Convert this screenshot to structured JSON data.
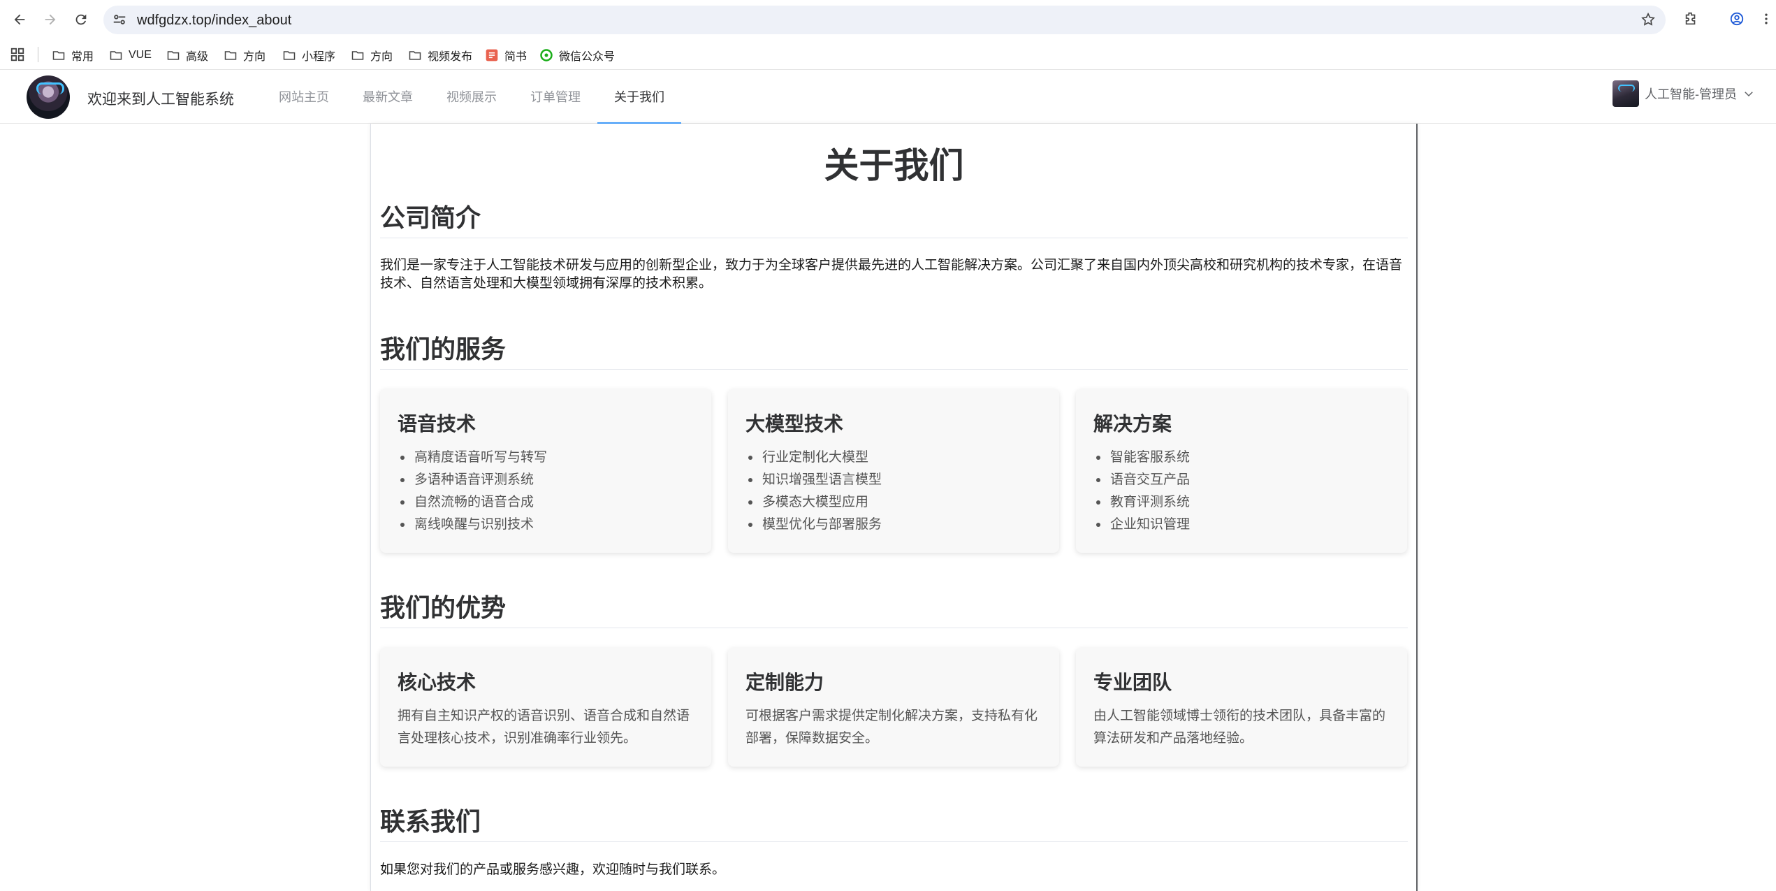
{
  "browser": {
    "url": "wdfgdzx.top/index_about",
    "bookmarks": [
      "常用",
      "VUE",
      "高级",
      "方向",
      "小程序",
      "方向",
      "视频发布",
      "简书",
      "微信公众号"
    ]
  },
  "header": {
    "site_title": "欢迎来到人工智能系统",
    "menu": [
      "网站主页",
      "最新文章",
      "视频展示",
      "订单管理",
      "关于我们"
    ],
    "active_menu": "关于我们",
    "user_label": "人工智能-管理员"
  },
  "page": {
    "title": "关于我们",
    "intro": {
      "heading": "公司简介",
      "text": "我们是一家专注于人工智能技术研发与应用的创新型企业，致力于为全球客户提供最先进的人工智能解决方案。公司汇聚了来自国内外顶尖高校和研究机构的技术专家，在语音技术、自然语言处理和大模型领域拥有深厚的技术积累。"
    },
    "services": {
      "heading": "我们的服务",
      "cards": [
        {
          "title": "语音技术",
          "items": [
            "高精度语音听写与转写",
            "多语种语音评测系统",
            "自然流畅的语音合成",
            "离线唤醒与识别技术"
          ]
        },
        {
          "title": "大模型技术",
          "items": [
            "行业定制化大模型",
            "知识增强型语言模型",
            "多模态大模型应用",
            "模型优化与部署服务"
          ]
        },
        {
          "title": "解决方案",
          "items": [
            "智能客服系统",
            "语音交互产品",
            "教育评测系统",
            "企业知识管理"
          ]
        }
      ]
    },
    "advantages": {
      "heading": "我们的优势",
      "cards": [
        {
          "title": "核心技术",
          "desc": "拥有自主知识产权的语音识别、语音合成和自然语言处理核心技术，识别准确率行业领先。"
        },
        {
          "title": "定制能力",
          "desc": "可根据客户需求提供定制化解决方案，支持私有化部署，保障数据安全。"
        },
        {
          "title": "专业团队",
          "desc": "由人工智能领域博士领衔的技术团队，具备丰富的算法研发和产品落地经验。"
        }
      ]
    },
    "contact": {
      "heading": "联系我们",
      "text": "如果您对我们的产品或服务感兴趣，欢迎随时与我们联系。"
    }
  },
  "colors": {
    "accent": "#409eff",
    "menu_inactive": "#909399",
    "text": "#303133",
    "card_bg": "#f8f8f8"
  }
}
